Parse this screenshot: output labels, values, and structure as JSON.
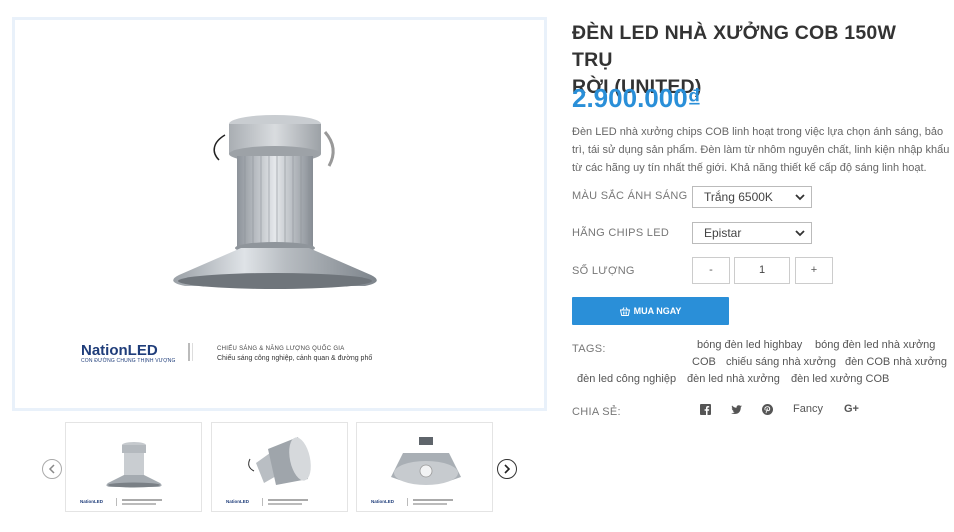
{
  "product": {
    "title_line1": "ĐÈN LED NHÀ XƯỞNG COB 150W TRỤ",
    "title_line2": "RỜI (UNITED)",
    "price": "2.900.000₫",
    "description": "Đèn LED nhà xưởng chips COB linh hoạt trong việc lựa chọn ánh sáng, bảo trì, tái sử dụng sản phẩm. Đèn làm từ nhôm nguyên chất, linh kiện nhập khẩu từ các hãng uy tín nhất thế giới. Khả năng thiết kế cấp độ sáng linh hoạt."
  },
  "image": {
    "brand_name": "NationLED",
    "brand_tagline": "CON ĐƯỜNG CHUNG THỊNH VƯỢNG",
    "tagline1": "CHIẾU SÁNG & NĂNG LƯỢNG QUỐC GIA",
    "tagline2": "Chiếu sáng công nghiệp, cảnh quan & đường phố",
    "thumb_logo": "NationLED"
  },
  "options": {
    "color_label": "MÀU SẮC ÁNH SÁNG",
    "color_value": "Trắng 6500K",
    "chip_label": "HÃNG CHIPS LED",
    "chip_value": "Epistar",
    "qty_label": "SỐ LƯỢNG",
    "qty_minus": "-",
    "qty_value": "1",
    "qty_plus": "+"
  },
  "buy_button": {
    "label": "MUA NGAY",
    "icon": "basket-icon"
  },
  "tags": {
    "label": "TAGS:",
    "items": [
      "bóng đèn led highbay",
      "bóng đèn led nhà xưởng",
      "COB",
      "chiếu sáng nhà xưởng",
      "đèn COB nhà xưởng",
      "đèn led công nghiệp",
      "đèn led nhà xưởng",
      "đèn led xưởng COB"
    ]
  },
  "share": {
    "label": "CHIA SẺ:",
    "facebook_icon": "facebook-icon",
    "twitter_icon": "twitter-icon",
    "pinterest_icon": "pinterest-icon",
    "fancy": "Fancy",
    "gplus": "G+"
  },
  "colors": {
    "accent": "#2a8fd8",
    "title": "#333333",
    "brand": "#1f3d7a"
  }
}
